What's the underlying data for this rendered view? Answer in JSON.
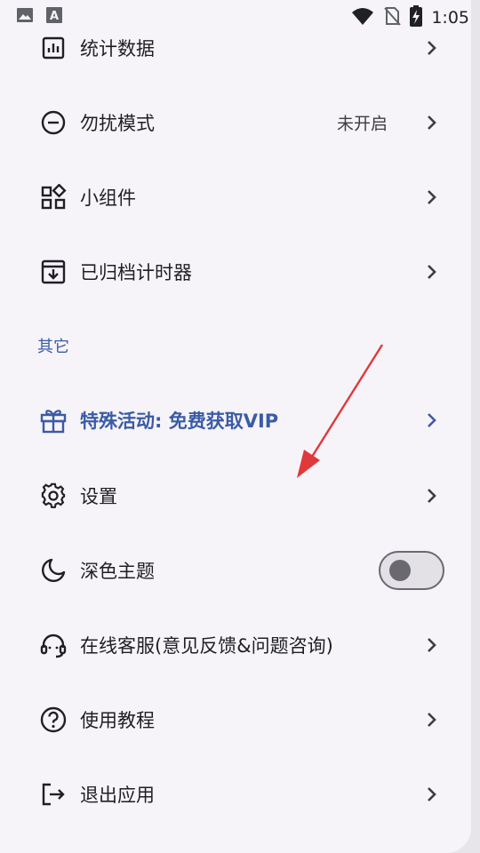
{
  "status_bar": {
    "time": "1:05",
    "left_icons": [
      "image-icon",
      "font-icon"
    ],
    "right_icons": [
      "wifi-icon",
      "no-sim-icon",
      "battery-charging-icon"
    ]
  },
  "menu_top": [
    {
      "label": "统计数据",
      "icon": "bar-chart-icon",
      "value": ""
    },
    {
      "label": "勿扰模式",
      "icon": "minus-circle-icon",
      "value": "未开启"
    },
    {
      "label": "小组件",
      "icon": "widgets-icon",
      "value": ""
    },
    {
      "label": "已归档计时器",
      "icon": "archive-icon",
      "value": ""
    }
  ],
  "section_other": {
    "title": "其它"
  },
  "menu_other": [
    {
      "label": "特殊活动: 免费获取VIP",
      "icon": "gift-icon"
    },
    {
      "label": "设置",
      "icon": "gear-icon"
    },
    {
      "label": "深色主题",
      "icon": "moon-icon",
      "toggle_on": false
    },
    {
      "label": "在线客服(意见反馈&问题咨询)",
      "icon": "headset-icon"
    },
    {
      "label": "使用教程",
      "icon": "help-circle-icon"
    },
    {
      "label": "退出应用",
      "icon": "logout-icon"
    }
  ],
  "colors": {
    "accent": "#3b5ba5",
    "background": "#f6f4f9",
    "annotation_arrow": "#e0393b"
  }
}
